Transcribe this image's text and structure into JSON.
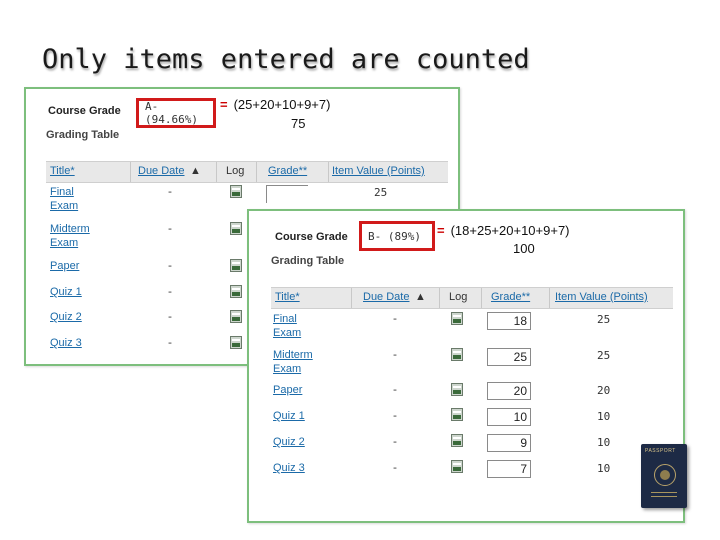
{
  "slide_title": "Only items entered are counted",
  "back": {
    "course_grade_label": "Course Grade",
    "course_grade_value": "A- (94.66%)",
    "grading_table_label": "Grading Table",
    "formula_eq": "=",
    "formula_sum": "(25+20+10+9+7)",
    "formula_den": "75",
    "headers": [
      "Title*",
      "Due Date",
      "Log",
      "Grade**",
      "Item Value (Points)"
    ],
    "rows": [
      {
        "title1": "Final",
        "title2": "Exam",
        "due": "-",
        "grade": "",
        "value": "25"
      },
      {
        "title1": "Midterm",
        "title2": "Exam",
        "due": "-",
        "grade": "",
        "value": ""
      },
      {
        "title1": "Paper",
        "title2": "",
        "due": "-",
        "grade": "",
        "value": ""
      },
      {
        "title1": "Quiz 1",
        "title2": "",
        "due": "-",
        "grade": "",
        "value": ""
      },
      {
        "title1": "Quiz 2",
        "title2": "",
        "due": "-",
        "grade": "",
        "value": ""
      },
      {
        "title1": "Quiz 3",
        "title2": "",
        "due": "-",
        "grade": "",
        "value": ""
      }
    ]
  },
  "front": {
    "course_grade_label": "Course Grade",
    "course_grade_value": "B- (89%)",
    "grading_table_label": "Grading Table",
    "formula_eq": "=",
    "formula_sum": "(18+25+20+10+9+7)",
    "formula_den": "100",
    "headers": [
      "Title*",
      "Due Date",
      "Log",
      "Grade**",
      "Item Value (Points)"
    ],
    "rows": [
      {
        "title1": "Final",
        "title2": "Exam",
        "due": "-",
        "grade": "18",
        "value": "25"
      },
      {
        "title1": "Midterm",
        "title2": "Exam",
        "due": "-",
        "grade": "25",
        "value": "25"
      },
      {
        "title1": "Paper",
        "title2": "",
        "due": "-",
        "grade": "20",
        "value": "20"
      },
      {
        "title1": "Quiz 1",
        "title2": "",
        "due": "-",
        "grade": "10",
        "value": "10"
      },
      {
        "title1": "Quiz 2",
        "title2": "",
        "due": "-",
        "grade": "9",
        "value": "10"
      },
      {
        "title1": "Quiz 3",
        "title2": "",
        "due": "-",
        "grade": "7",
        "value": "10"
      }
    ]
  },
  "passport_text": "PASSPORT",
  "colors": {
    "highlight": "#d11a1a",
    "panel_border": "#7dbf7d",
    "link": "#1b6aa8",
    "passport": "#1d2a45"
  }
}
